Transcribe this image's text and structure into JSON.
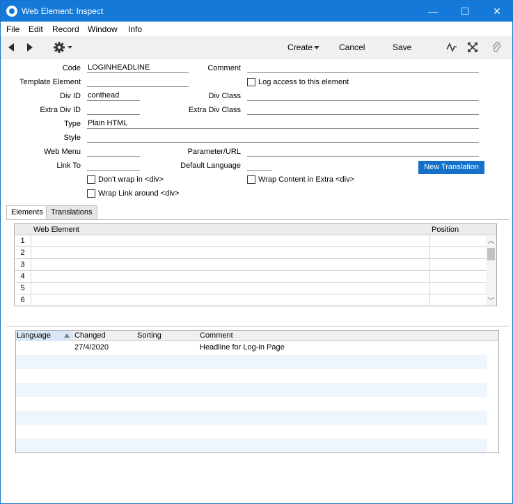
{
  "window": {
    "title": "Web Element: Inspect"
  },
  "menu": [
    "File",
    "Edit",
    "Record",
    "Window",
    "Info"
  ],
  "toolbar": {
    "create": "Create",
    "cancel": "Cancel",
    "save": "Save"
  },
  "form": {
    "code_label": "Code",
    "code_value": "LOGINHEADLINE",
    "comment_label": "Comment",
    "comment_value": "",
    "template_label": "Template Element",
    "template_value": "",
    "log_access_label": "Log access to this element",
    "divid_label": "Div ID",
    "divid_value": "conthead",
    "divclass_label": "Div Class",
    "divclass_value": "",
    "extradivid_label": "Extra Div ID",
    "extradivid_value": "",
    "extradivclass_label": "Extra Div Class",
    "extradivclass_value": "",
    "type_label": "Type",
    "type_value": "Plain HTML",
    "style_label": "Style",
    "style_value": "",
    "webmenu_label": "Web Menu",
    "webmenu_value": "",
    "paramurl_label": "Parameter/URL",
    "paramurl_value": "",
    "linkto_label": "Link To",
    "linkto_value": "",
    "deflang_label": "Default Language",
    "deflang_value": "",
    "new_translation": "New Translation",
    "dont_wrap_label": "Don't wrap in <div>",
    "wrap_content_label": "Wrap Content in Extra <div>",
    "wrap_link_label": "Wrap Link around <div>"
  },
  "tabs": [
    "Elements",
    "Translations"
  ],
  "matrix": {
    "col_web_element": "Web Element",
    "col_position": "Position",
    "rows": [
      "1",
      "2",
      "3",
      "4",
      "5",
      "6"
    ]
  },
  "translations": {
    "headers": {
      "language": "Language",
      "changed": "Changed",
      "sorting": "Sorting",
      "comment": "Comment"
    },
    "rows": [
      {
        "language": "",
        "changed": "27/4/2020",
        "sorting": "",
        "comment": "Headline for Log-in Page"
      }
    ]
  },
  "colors": {
    "titlebar": "#1479d8",
    "accent_button": "#1470c8",
    "row_alt": "#eef5fd"
  },
  "icons": [
    "app-icon",
    "minimize-icon",
    "maximize-icon",
    "close-icon",
    "back-icon",
    "forward-icon",
    "gear-icon",
    "pulse-icon",
    "expand-icon",
    "paperclip-icon",
    "sort-asc-icon"
  ]
}
